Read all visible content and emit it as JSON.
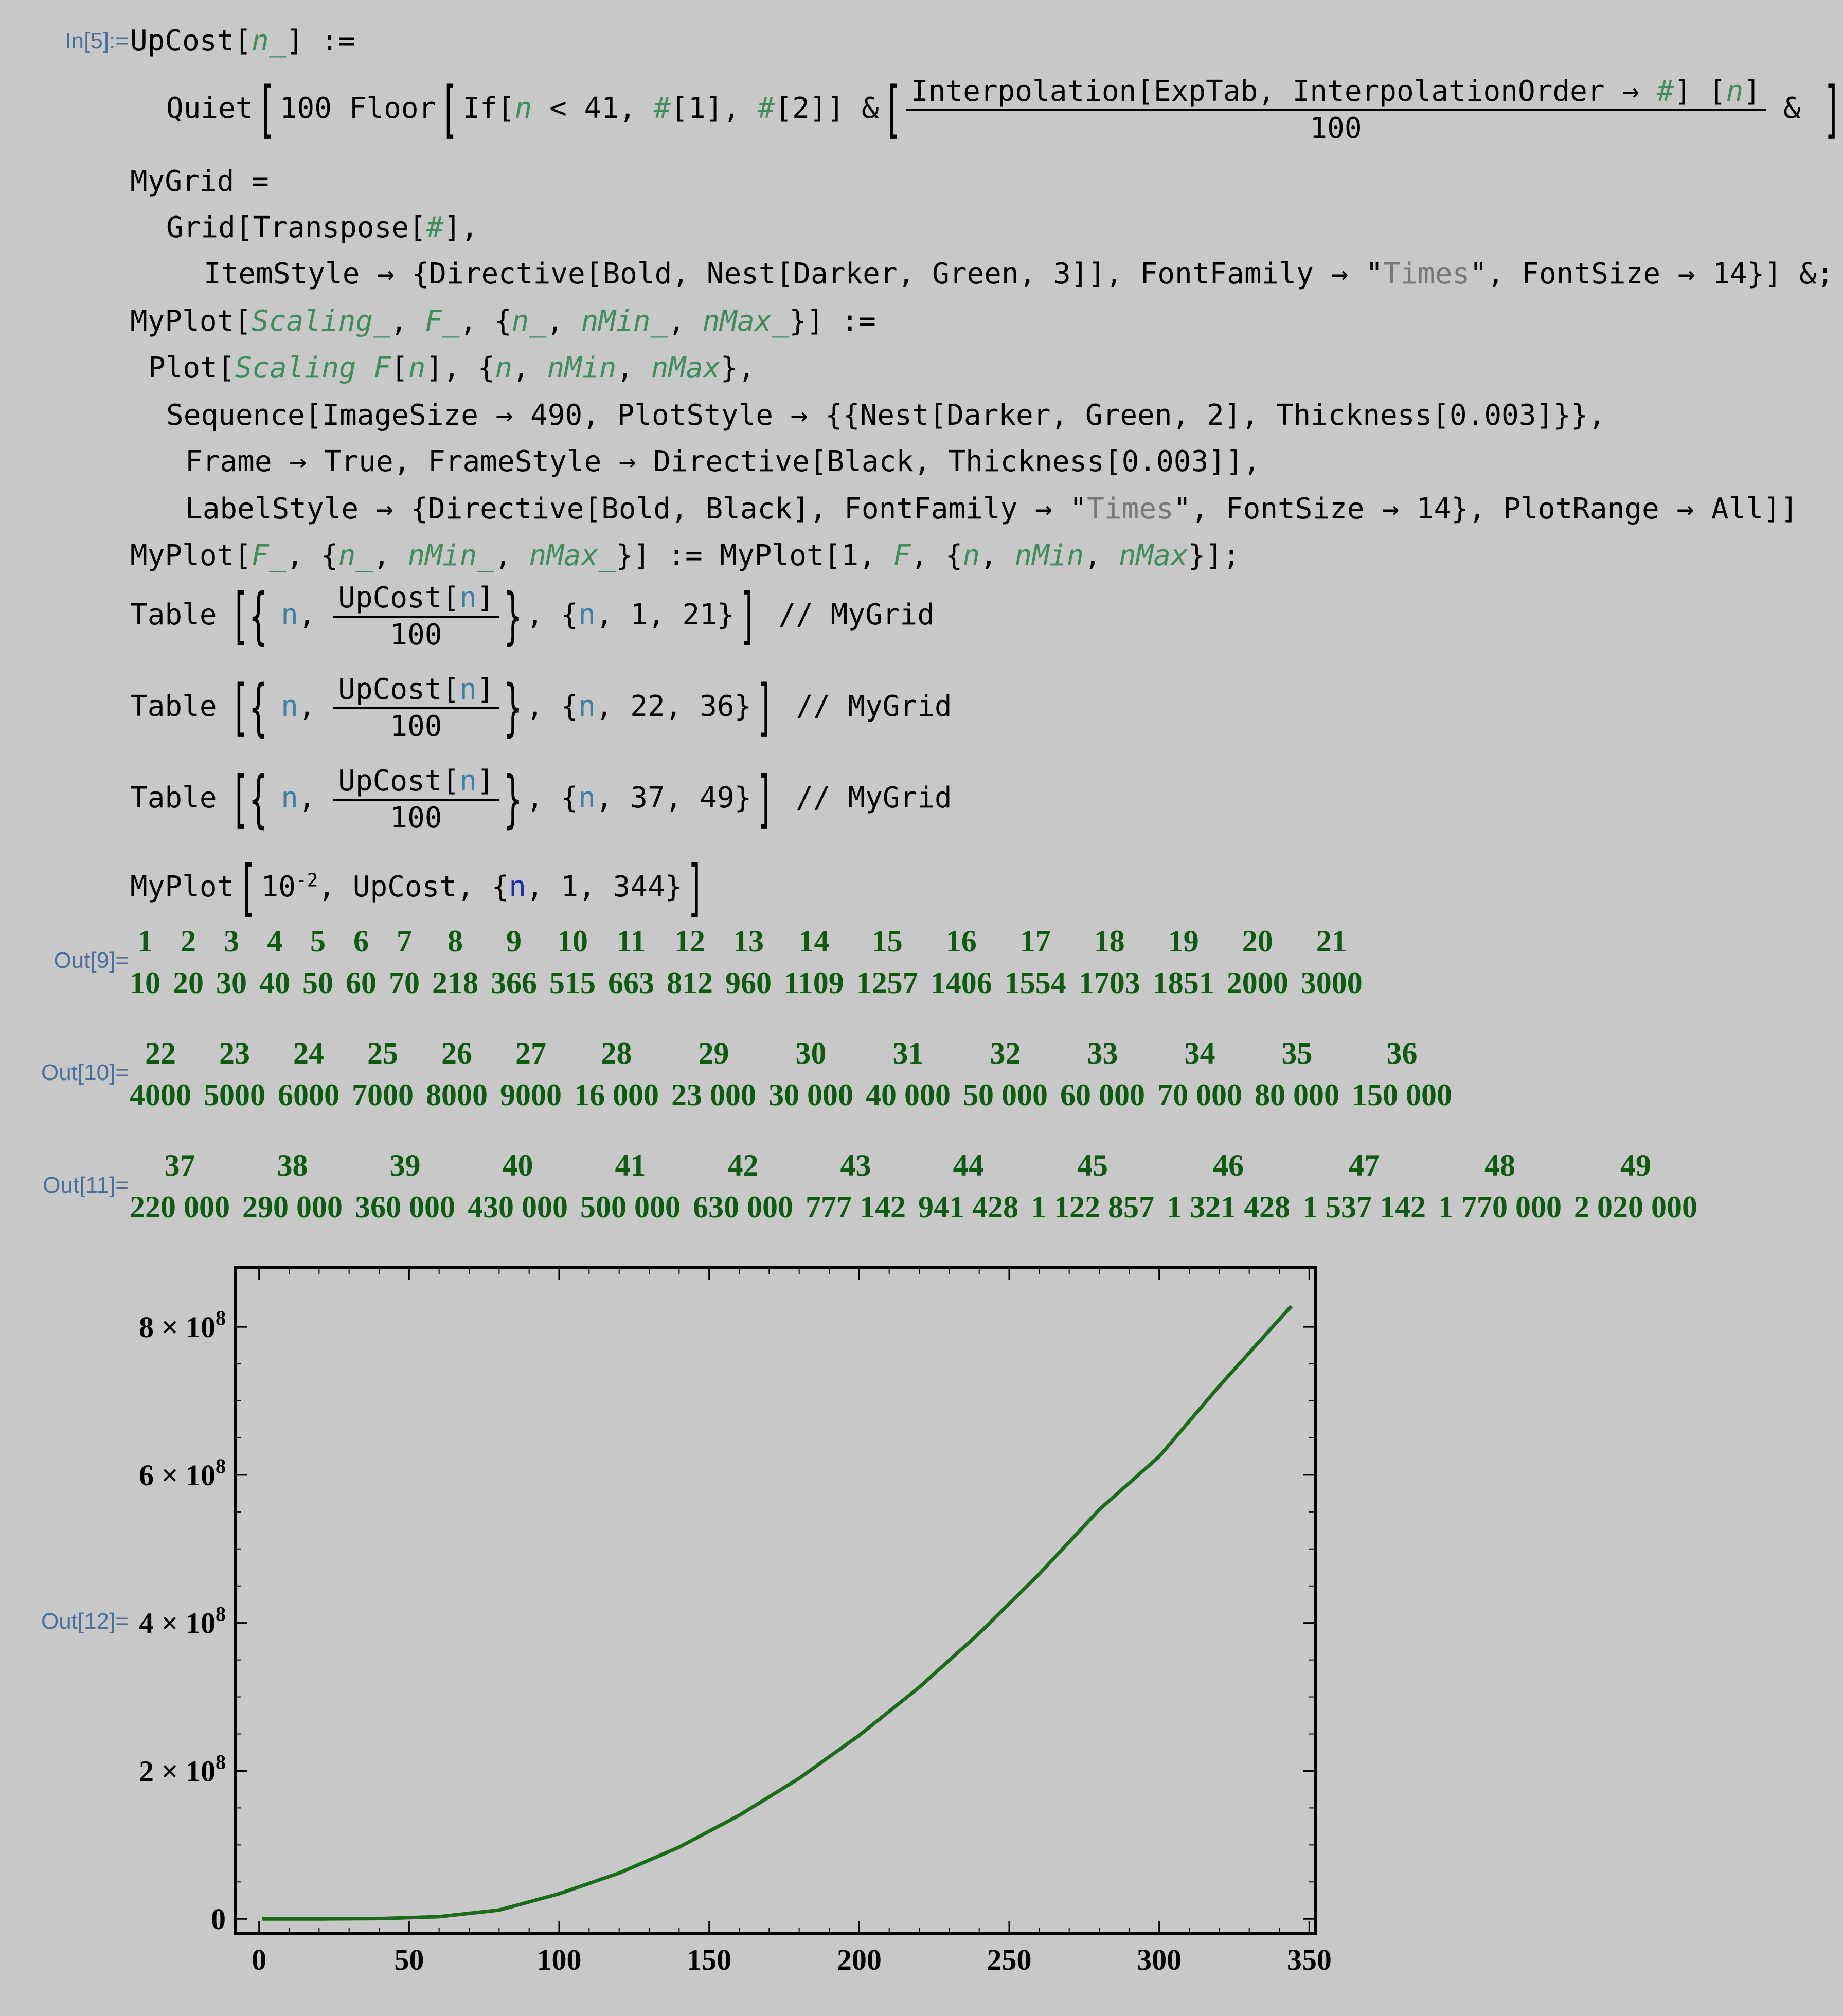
{
  "labels": {
    "in5": "In[5]:=",
    "out9": "Out[9]=",
    "out10": "Out[10]=",
    "out11": "Out[11]=",
    "out12": "Out[12]="
  },
  "code": {
    "l1_a": "UpCost[",
    "l1_b": "n_",
    "l1_c": "] :=",
    "l2_a": "Quiet",
    "l2_b": "100 Floor",
    "l2_c": "If[",
    "l2_d": "n",
    "l2_e": " < 41, ",
    "l2_f": "#",
    "l2_g": "[1], ",
    "l2_h": "#",
    "l2_i": "[2]] &",
    "l2_num_a": "Interpolation[ExpTab, InterpolationOrder → ",
    "l2_num_b": "#",
    "l2_num_c": "] [",
    "l2_num_d": "n",
    "l2_num_e": "]",
    "l2_den": "100",
    "l2_end": " &",
    "l2_semi": ";",
    "l3": "MyGrid =",
    "l4_a": "Grid[Transpose[",
    "l4_b": "#",
    "l4_c": "],",
    "l5_a": "ItemStyle → {Directive[Bold, Nest[Darker, Green, 3]], FontFamily → \"",
    "l5_b": "Times",
    "l5_c": "\", FontSize → 14}] &;",
    "l6_a": "MyPlot[",
    "l6_b": "Scaling_",
    "l6_c": ", ",
    "l6_d": "F_",
    "l6_e": ", {",
    "l6_f": "n_",
    "l6_g": ", ",
    "l6_h": "nMin_",
    "l6_i": ", ",
    "l6_j": "nMax_",
    "l6_k": "}] :=",
    "l7_a": "Plot[",
    "l7_b": "Scaling F",
    "l7_c": "[",
    "l7_d": "n",
    "l7_e": "], {",
    "l7_f": "n",
    "l7_g": ", ",
    "l7_h": "nMin",
    "l7_i": ", ",
    "l7_j": "nMax",
    "l7_k": "},",
    "l8": "Sequence[ImageSize → 490, PlotStyle → {{Nest[Darker, Green, 2], Thickness[0.003]}},",
    "l9": "Frame → True, FrameStyle → Directive[Black, Thickness[0.003]],",
    "l10_a": "LabelStyle → {Directive[Bold, Black], FontFamily → \"",
    "l10_b": "Times",
    "l10_c": "\", FontSize → 14}, PlotRange → All]]",
    "l11_a": "MyPlot[",
    "l11_b": "F_",
    "l11_c": ", {",
    "l11_d": "n_",
    "l11_e": ", ",
    "l11_f": "nMin_",
    "l11_g": ", ",
    "l11_h": "nMax_",
    "l11_i": "}] := MyPlot[1, ",
    "l11_j": "F",
    "l11_k": ", {",
    "l11_l": "n",
    "l11_m": ", ",
    "l11_n": "nMin",
    "l11_o": ", ",
    "l11_p": "nMax",
    "l11_q": "}];",
    "table_kw": "Table",
    "table_n": "n",
    "table_comma": ", ",
    "table_num": "UpCost[",
    "table_num_n": "n",
    "table_num_close": "]",
    "table_den": "100",
    "t1_range_a": ", {",
    "t1_range_n": "n",
    "t1_range_b": ", 1, 21}",
    "t2_range_b": ", 22, 36}",
    "t3_range_b": ", 37, 49}",
    "table_suffix": " // MyGrid",
    "l15_a": "MyPlot",
    "l15_b": "10",
    "l15_sup": "-2",
    "l15_c": ", UpCost, {",
    "l15_d": "n",
    "l15_e": ", 1, 344}"
  },
  "grid1": {
    "n": [
      "1",
      "2",
      "3",
      "4",
      "5",
      "6",
      "7",
      "8",
      "9",
      "10",
      "11",
      "12",
      "13",
      "14",
      "15",
      "16",
      "17",
      "18",
      "19",
      "20",
      "21"
    ],
    "v": [
      "10",
      "20",
      "30",
      "40",
      "50",
      "60",
      "70",
      "218",
      "366",
      "515",
      "663",
      "812",
      "960",
      "1109",
      "1257",
      "1406",
      "1554",
      "1703",
      "1851",
      "2000",
      "3000"
    ]
  },
  "grid2": {
    "n": [
      "22",
      "23",
      "24",
      "25",
      "26",
      "27",
      "28",
      "29",
      "30",
      "31",
      "32",
      "33",
      "34",
      "35",
      "36"
    ],
    "v": [
      "4000",
      "5000",
      "6000",
      "7000",
      "8000",
      "9000",
      "16 000",
      "23 000",
      "30 000",
      "40 000",
      "50 000",
      "60 000",
      "70 000",
      "80 000",
      "150 000"
    ]
  },
  "grid3": {
    "n": [
      "37",
      "38",
      "39",
      "40",
      "41",
      "42",
      "43",
      "44",
      "45",
      "46",
      "47",
      "48",
      "49"
    ],
    "v": [
      "220 000",
      "290 000",
      "360 000",
      "430 000",
      "500 000",
      "630 000",
      "777 142",
      "941 428",
      "1 122 857",
      "1 321 428",
      "1 537 142",
      "1 770 000",
      "2 020 000"
    ]
  },
  "chart_data": {
    "type": "line",
    "x_ticks": [
      "0",
      "50",
      "100",
      "150",
      "200",
      "250",
      "300",
      "350"
    ],
    "y_ticks": [
      {
        "value": 0,
        "mant": "0",
        "exp": ""
      },
      {
        "value": 200000000,
        "mant": "2 × 10",
        "exp": "8"
      },
      {
        "value": 400000000,
        "mant": "4 × 10",
        "exp": "8"
      },
      {
        "value": 600000000,
        "mant": "6 × 10",
        "exp": "8"
      },
      {
        "value": 800000000,
        "mant": "8 × 10",
        "exp": "8"
      }
    ],
    "xlim": [
      -8,
      352
    ],
    "ylim": [
      -20000000,
      880000000
    ],
    "series": [
      {
        "color": "#1a6b1a",
        "points": [
          [
            1,
            0
          ],
          [
            21,
            300
          ],
          [
            41,
            500000
          ],
          [
            60,
            3000000
          ],
          [
            80,
            12000000
          ],
          [
            100,
            34000000
          ],
          [
            120,
            62000000
          ],
          [
            140,
            97000000
          ],
          [
            160,
            140000000
          ],
          [
            180,
            190000000
          ],
          [
            200,
            248000000
          ],
          [
            220,
            313000000
          ],
          [
            240,
            386000000
          ],
          [
            260,
            466000000
          ],
          [
            280,
            553000000
          ],
          [
            300,
            625000000
          ],
          [
            320,
            720000000
          ],
          [
            344,
            828000000
          ]
        ]
      }
    ]
  }
}
